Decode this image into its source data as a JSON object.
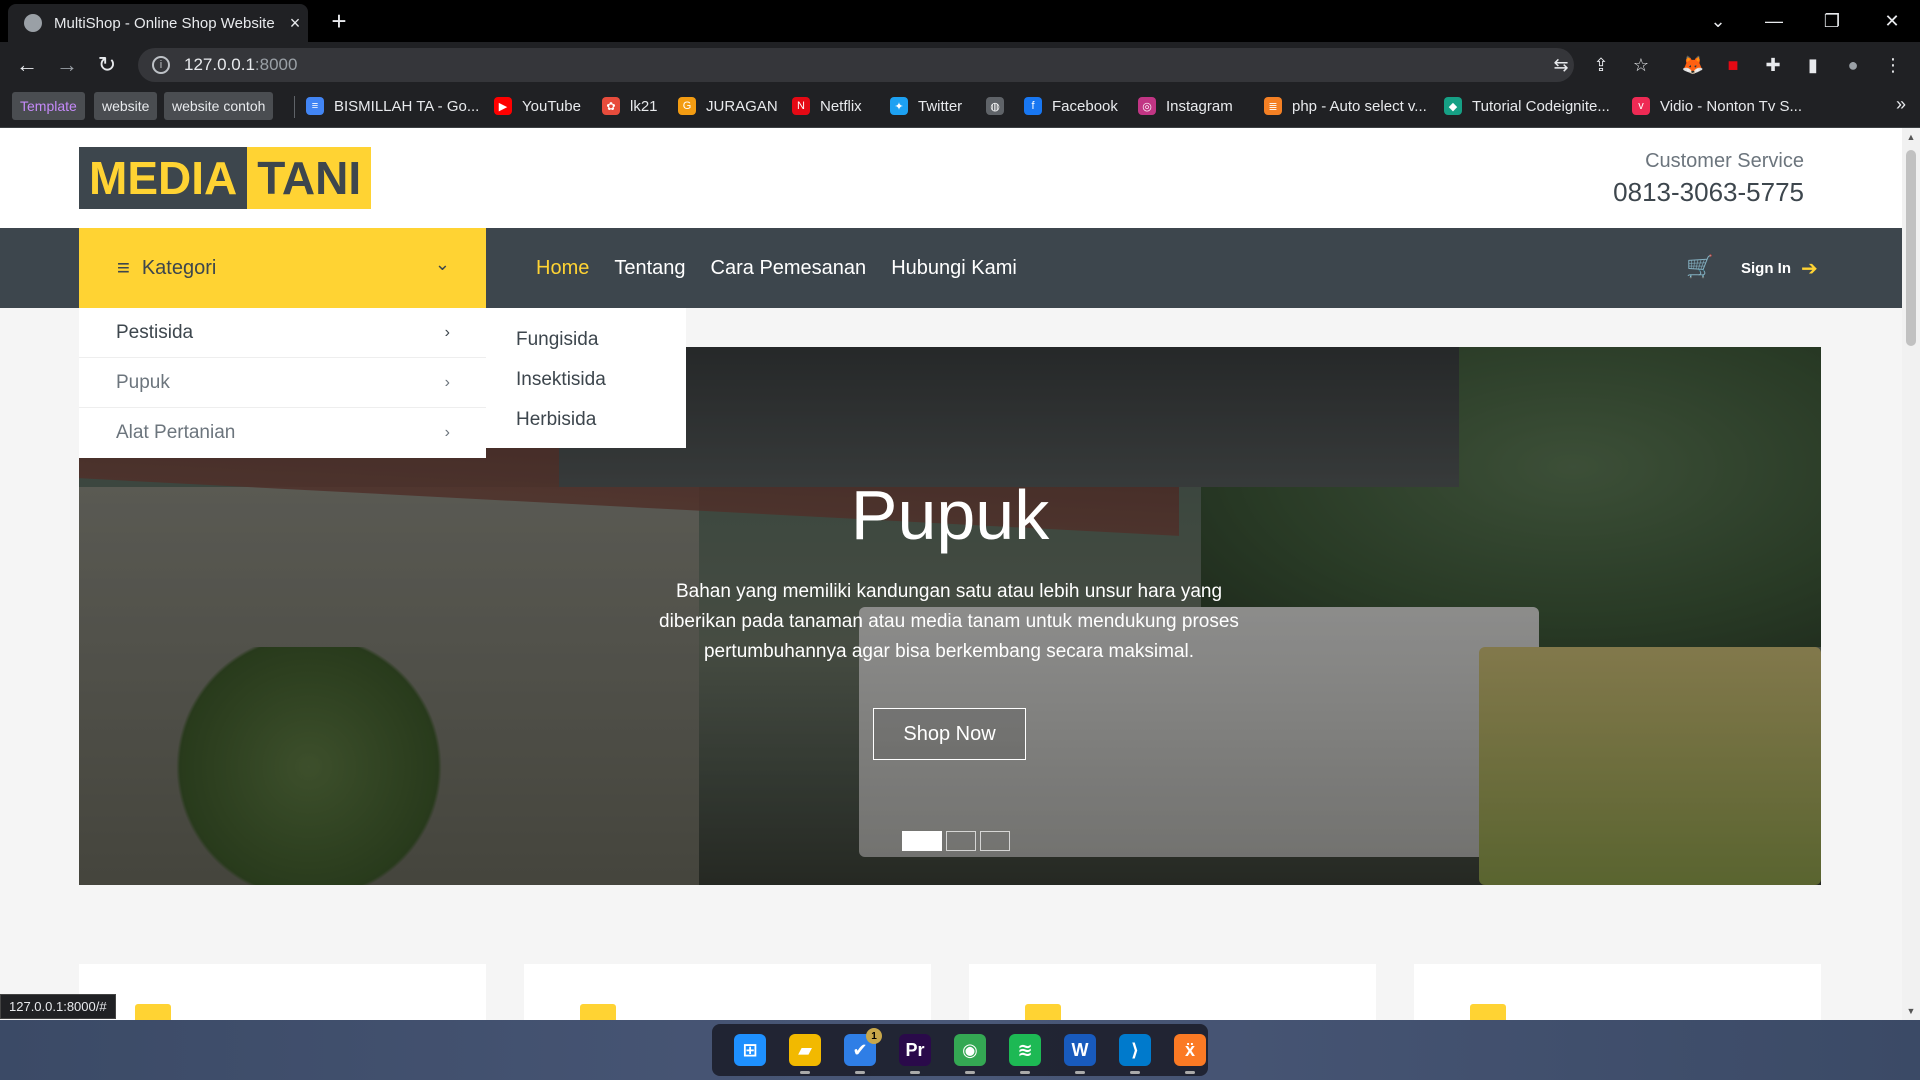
{
  "browser": {
    "tab_title": "MultiShop - Online Shop Website",
    "tab_close": "×",
    "new_tab": "+",
    "url_host": "127.0.0.1",
    "url_port": ":8000",
    "window_controls": {
      "dropdown": "⌄",
      "minimize": "—",
      "restore": "❐",
      "close": "✕"
    },
    "nav": {
      "back": "←",
      "forward": "→",
      "reload": "↻"
    },
    "toolbar_icons": {
      "translate": "⇆",
      "share": "⇪",
      "star": "☆",
      "ext1": "🦊",
      "ext2": "■",
      "puzzle": "✚",
      "sidepanel": "▮",
      "profile": "●",
      "menu": "⋮"
    },
    "bookmarks_folders": [
      "Template",
      "website",
      "website contoh"
    ],
    "bookmarks": [
      {
        "label": "BISMILLAH TA - Go...",
        "color": "#4285f4",
        "glyph": "≡"
      },
      {
        "label": "YouTube",
        "color": "#ff0000",
        "glyph": "▶"
      },
      {
        "label": "lk21",
        "color": "#e74c3c",
        "glyph": "✿"
      },
      {
        "label": "JURAGAN",
        "color": "#f39c12",
        "glyph": "G"
      },
      {
        "label": "Netflix",
        "color": "#e50914",
        "glyph": "N"
      },
      {
        "label": "Twitter",
        "color": "#1da1f2",
        "glyph": "✦"
      },
      {
        "label": "",
        "color": "#5f6368",
        "glyph": "◍"
      },
      {
        "label": "Facebook",
        "color": "#1877f2",
        "glyph": "f"
      },
      {
        "label": "Instagram",
        "color": "#c13584",
        "glyph": "◎"
      },
      {
        "label": "php - Auto select v...",
        "color": "#f48024",
        "glyph": "≣"
      },
      {
        "label": "Tutorial Codeignite...",
        "color": "#16a085",
        "glyph": "◆"
      },
      {
        "label": "Vidio - Nonton Tv S...",
        "color": "#ee2a54",
        "glyph": "v"
      }
    ],
    "bookmarks_more": "»",
    "status_url": "127.0.0.1:8000/#"
  },
  "site": {
    "logo_part1": "MEDIA",
    "logo_part2": "TANI",
    "customer_service_label": "Customer Service",
    "customer_service_phone": "0813-3063-5775",
    "kategori_label": "Kategori",
    "nav_links": [
      "Home",
      "Tentang",
      "Cara Pemesanan",
      "Hubungi Kami"
    ],
    "signin_label": "Sign In",
    "categories": [
      "Pestisida",
      "Pupuk",
      "Alat Pertanian"
    ],
    "submenu": [
      "Fungisida",
      "Insektisida",
      "Herbisida"
    ],
    "carousel": {
      "title": "Pupuk",
      "text": "Bahan yang memiliki kandungan satu atau lebih unsur hara yang diberikan pada tanaman atau media tanam untuk mendukung proses pertumbuhannya agar bisa berkembang secara maksimal.",
      "button": "Shop Now",
      "slides": 3,
      "active_slide": 1
    }
  },
  "taskbar": {
    "apps": [
      {
        "name": "start",
        "glyph": "⊞",
        "color": "#1e90ff"
      },
      {
        "name": "file-explorer",
        "glyph": "▰",
        "color": "#f2b900"
      },
      {
        "name": "todo",
        "glyph": "✔",
        "color": "#2f7ee6",
        "badge": "1"
      },
      {
        "name": "premiere",
        "glyph": "Pr",
        "color": "#2a0a4a"
      },
      {
        "name": "chrome",
        "glyph": "◉",
        "color": "#34a853"
      },
      {
        "name": "spotify",
        "glyph": "≋",
        "color": "#1db954"
      },
      {
        "name": "word",
        "glyph": "W",
        "color": "#185abd"
      },
      {
        "name": "vscode",
        "glyph": "⟩",
        "color": "#007acc"
      },
      {
        "name": "xampp",
        "glyph": "ẍ",
        "color": "#fb7a24"
      }
    ]
  }
}
